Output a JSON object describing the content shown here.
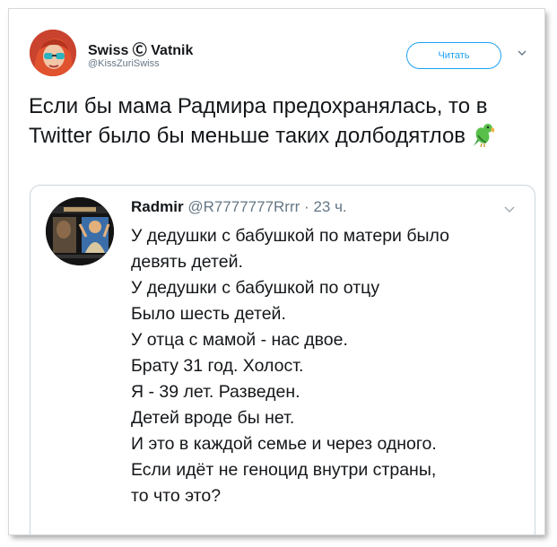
{
  "tweet": {
    "author_name": "Swiss Ⓒ Vatnik",
    "author_handle": "@KissZuriSwiss",
    "follow_label": "Читать",
    "text": "Если бы мама Радмира предохранялась, то в Twitter было бы меньше таких долбодятлов",
    "emoji": "parrot"
  },
  "quoted": {
    "name": "Radmir",
    "handle": "@R7777777Rrrr",
    "separator": "·",
    "time": "23 ч.",
    "lines": [
      "У дедушки с бабушкой по матери было",
      "девять детей.",
      "У дедушки с бабушкой по отцу",
      "Было шесть детей.",
      "У отца с мамой - нас двое.",
      "Брату 31 год. Холост.",
      "Я - 39 лет. Разведен.",
      "Детей вроде бы нет.",
      "И это в каждой семье и через одного.",
      "Если идёт не геноцид внутри страны,",
      "то что это?"
    ]
  },
  "colors": {
    "accent": "#1da1f2",
    "text": "#14171a",
    "secondary": "#657786",
    "border": "#ccd6dd"
  }
}
